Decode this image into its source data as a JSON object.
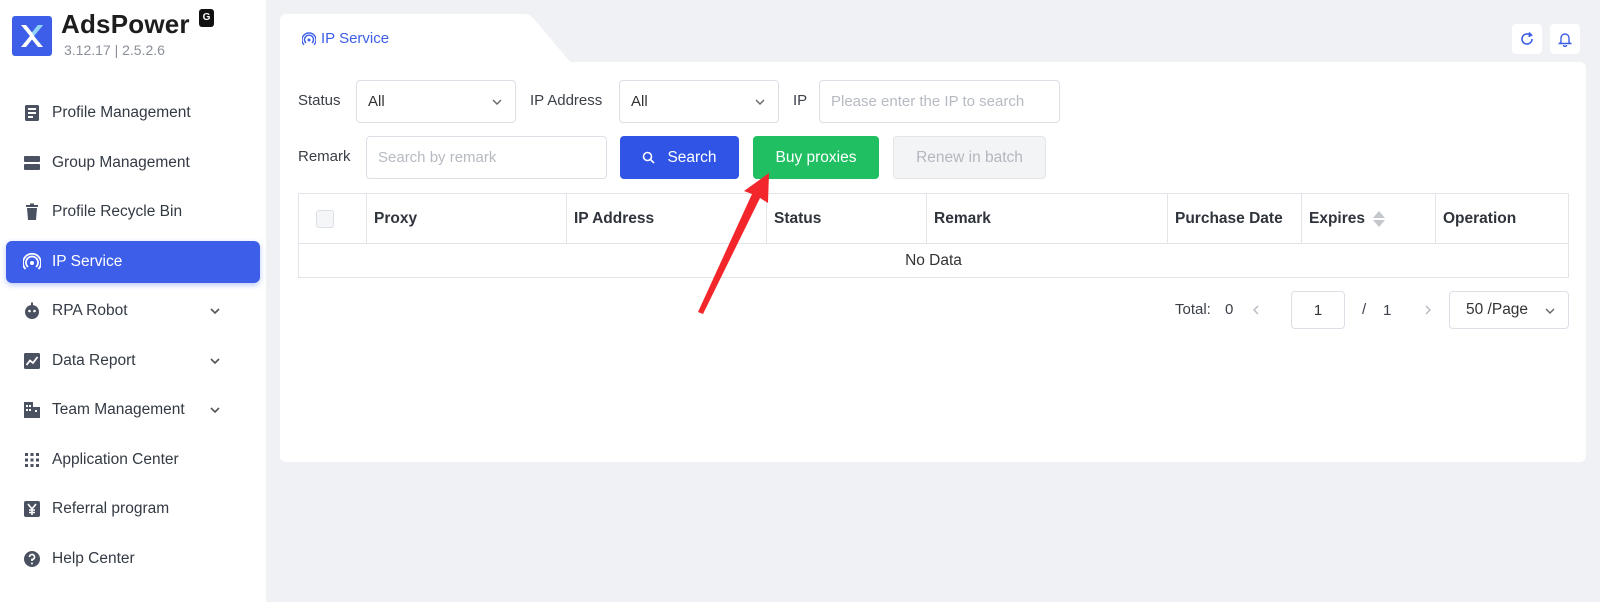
{
  "app": {
    "brand": "AdsPower",
    "badge": "G",
    "version": "3.12.17 | 2.5.2.6"
  },
  "sidebar": {
    "items": [
      {
        "label": "Profile Management",
        "icon": "profile-icon",
        "active": false,
        "expandable": false
      },
      {
        "label": "Group Management",
        "icon": "group-icon",
        "active": false,
        "expandable": false
      },
      {
        "label": "Profile Recycle Bin",
        "icon": "trash-icon",
        "active": false,
        "expandable": false
      },
      {
        "label": "IP Service",
        "icon": "ip-signal-icon",
        "active": true,
        "expandable": false
      },
      {
        "label": "RPA Robot",
        "icon": "robot-icon",
        "active": false,
        "expandable": true
      },
      {
        "label": "Data Report",
        "icon": "chart-icon",
        "active": false,
        "expandable": true
      },
      {
        "label": "Team Management",
        "icon": "team-icon",
        "active": false,
        "expandable": true
      },
      {
        "label": "Application Center",
        "icon": "grid-icon",
        "active": false,
        "expandable": false
      },
      {
        "label": "Referral program",
        "icon": "yen-icon",
        "active": false,
        "expandable": false
      },
      {
        "label": "Help Center",
        "icon": "help-icon",
        "active": false,
        "expandable": false
      }
    ]
  },
  "tab": {
    "label": "IP Service",
    "icon": "ip-signal-icon"
  },
  "filters": {
    "status_label": "Status",
    "status_value": "All",
    "ip_address_label": "IP Address",
    "ip_address_value": "All",
    "ip_label": "IP",
    "ip_placeholder": "Please enter the IP to search",
    "remark_label": "Remark",
    "remark_placeholder": "Search by remark"
  },
  "actions": {
    "search_label": "Search",
    "buy_label": "Buy proxies",
    "renew_label": "Renew in batch"
  },
  "table": {
    "columns": [
      "Proxy",
      "IP Address",
      "Status",
      "Remark",
      "Purchase Date",
      "Expires",
      "Operation"
    ],
    "empty_text": "No Data"
  },
  "pagination": {
    "total_label": "Total:",
    "total": "0",
    "current_page": "1",
    "separator": "/",
    "total_pages": "1",
    "page_size": "50 /Page"
  },
  "colors": {
    "accent": "#3d5ee8",
    "buy": "#1fbf62",
    "annotation_arrow": "#f2262b"
  }
}
